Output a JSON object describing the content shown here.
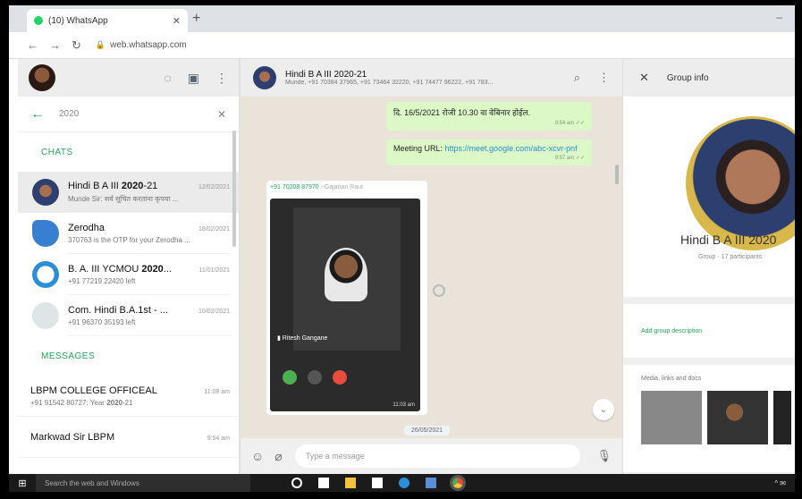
{
  "browser": {
    "tab_title": "(10) WhatsApp",
    "url": "web.whatsapp.com"
  },
  "sidebar": {
    "search_value": "2020",
    "chats_label": "CHATS",
    "messages_label": "MESSAGES",
    "chats": [
      {
        "name_prefix": "Hindi B A III ",
        "name_highlight": "2020",
        "name_suffix": "-21",
        "time": "12/02/2021",
        "preview": "Munde Sir: सर्व सूचित करतांना कृपया ..."
      },
      {
        "name_prefix": "Zerodha",
        "name_highlight": "",
        "name_suffix": "",
        "time": "18/02/2021",
        "preview": "370763 is the OTP for your Zerodha ..."
      },
      {
        "name_prefix": "B. A. III YCMOU ",
        "name_highlight": "2020",
        "name_suffix": "...",
        "time": "11/01/2021",
        "preview": "+91 77219 22420 left"
      },
      {
        "name_prefix": "Com. Hindi B.A.1st - ...",
        "name_highlight": "",
        "name_suffix": "",
        "time": "10/02/2021",
        "preview": "+91 96370 35193 left"
      }
    ],
    "messages": [
      {
        "name": "LBPM COLLEGE OFFICEAL",
        "time": "11:08 am",
        "preview_prefix": "+91 91542 80727: Year ",
        "preview_highlight": "2020",
        "preview_suffix": "-21"
      },
      {
        "name": "Markwad Sir LBPM",
        "time": "9:54 am",
        "preview_prefix": "",
        "preview_highlight": "",
        "preview_suffix": ""
      }
    ]
  },
  "conversation": {
    "name": "Hindi B A III 2020-21",
    "members": "Munde, +91 70384 37965, +91 73464 32220, +91 74477 96222, +91 783...",
    "bubble1_text": "दि. 16/5/2021 रोजी 10.30 वा वेबिनार होईल.",
    "bubble1_time": "9:54 am",
    "bubble2_label": "Meeting URL: ",
    "bubble2_link": "https://meet.google.com/abc-xcvr-pnf",
    "bubble2_time": "9:57 am",
    "video_sender": "+91 70208 87970",
    "video_sender_name": "~Gajanan Raut",
    "video_caption": "Ritesh Gangane",
    "video_time": "11:03 am",
    "date_chip": "26/05/2021",
    "message_placeholder": "Type a message"
  },
  "group_info": {
    "title": "Group info",
    "name": "Hindi B A III 2020",
    "meta": "Group · 17 participants",
    "add_description": "Add group description",
    "media_label": "Media, links and docs"
  },
  "taskbar": {
    "search_placeholder": "Search the web and Windows"
  },
  "colors": {
    "accent": "#1fa855",
    "bubble_out": "#dcf8c6",
    "chat_bg": "#e9e3d9"
  }
}
